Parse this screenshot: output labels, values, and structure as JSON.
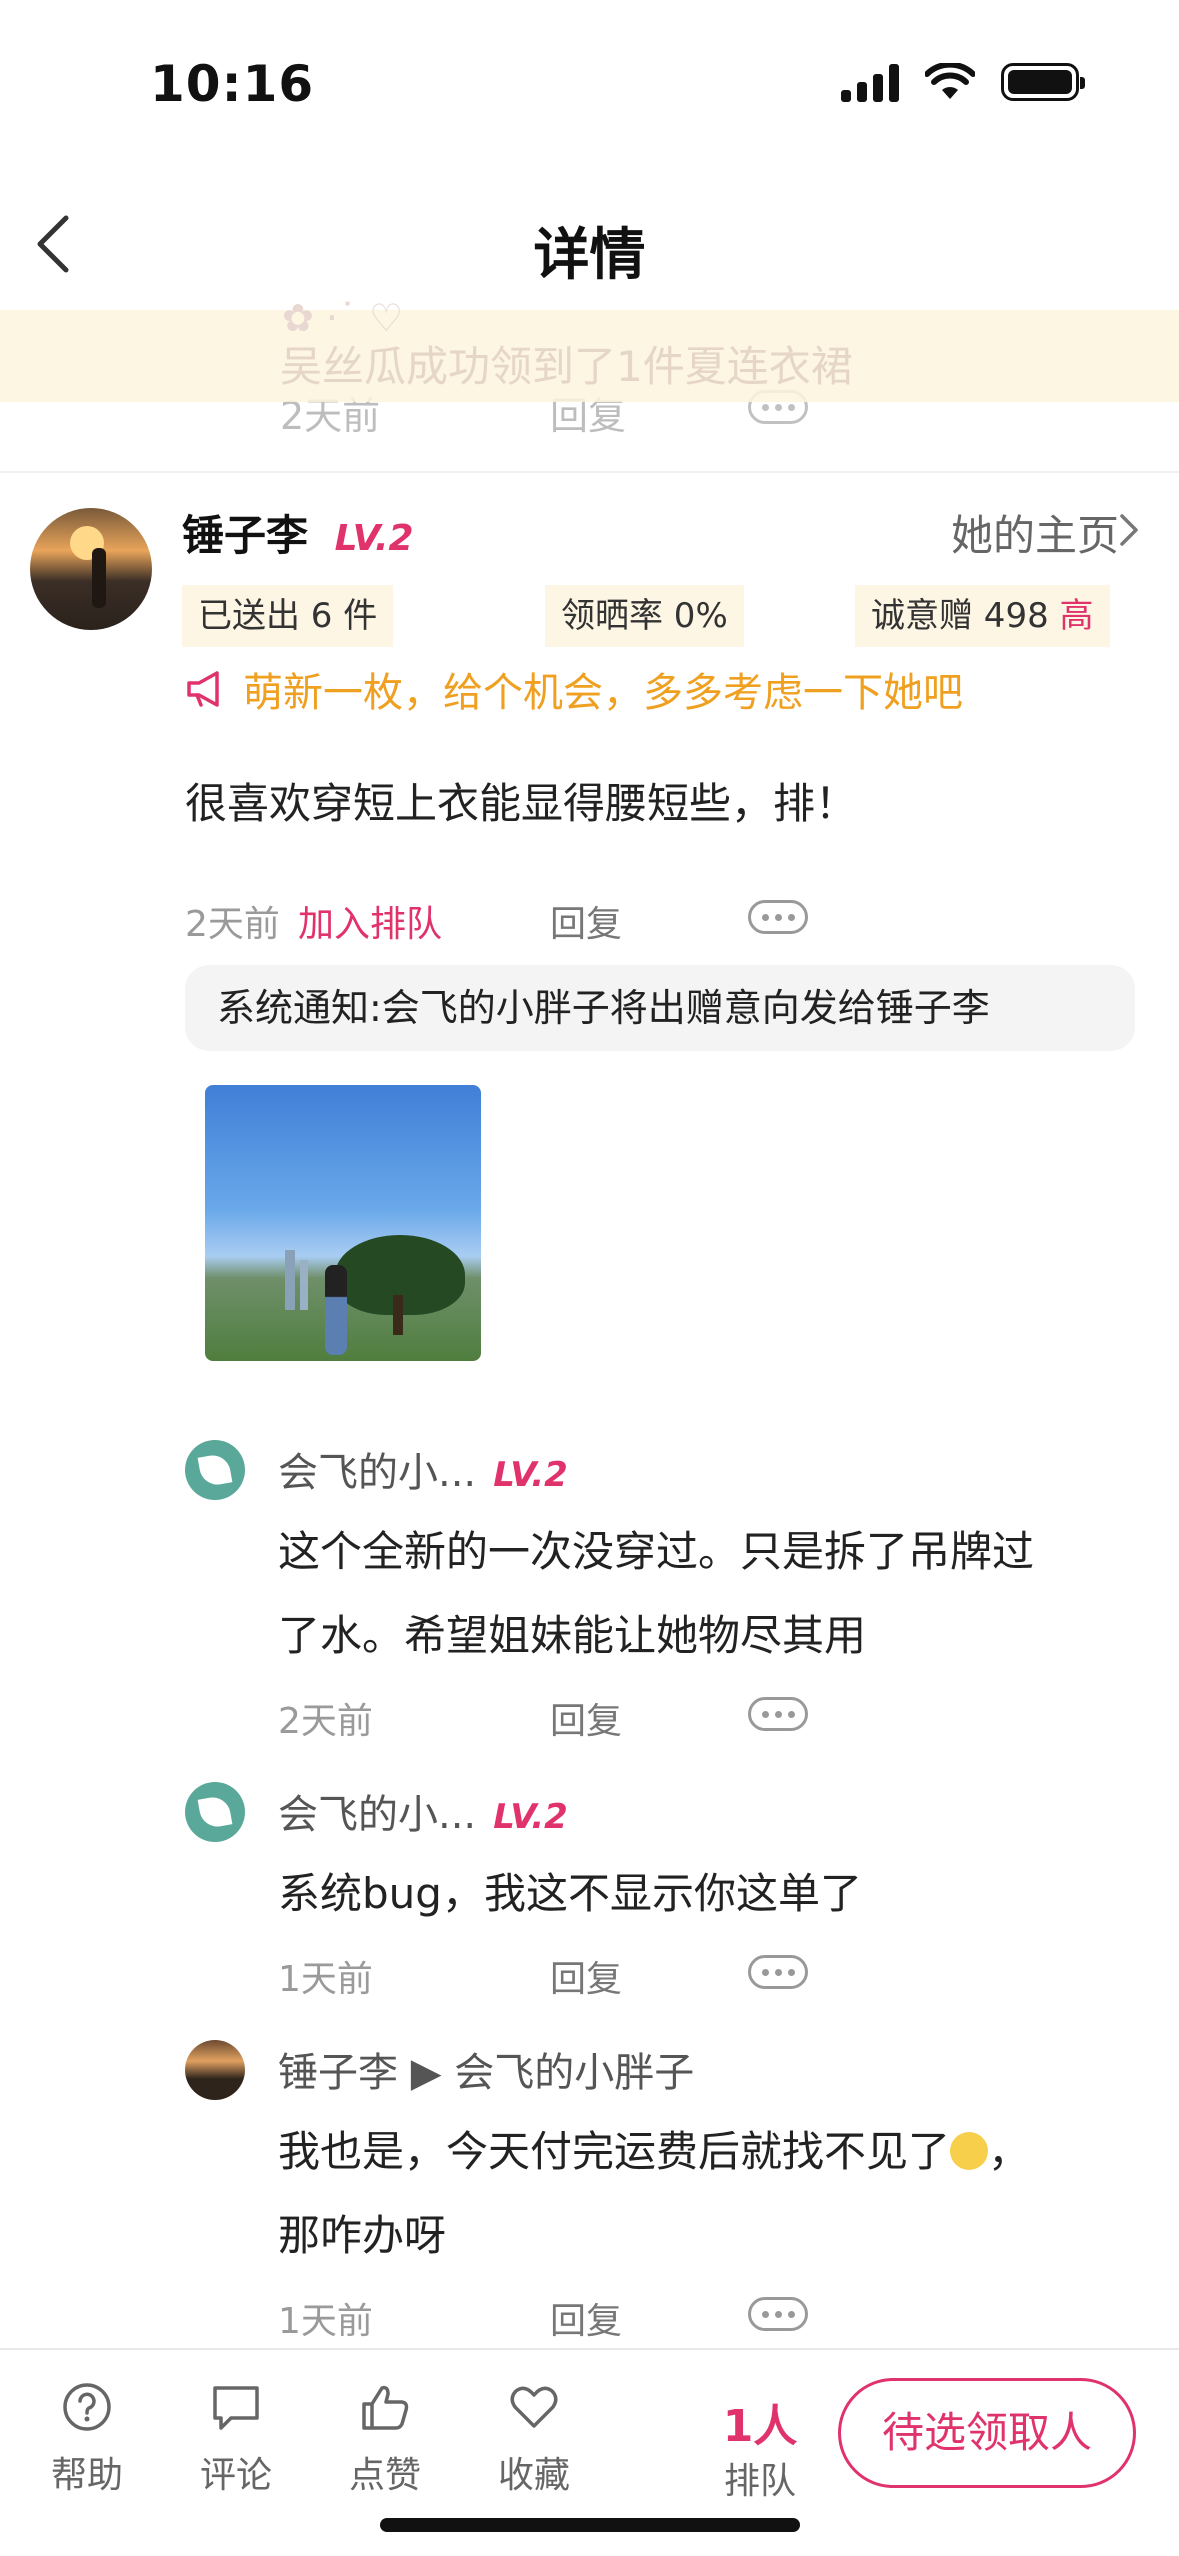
{
  "status_bar": {
    "time": "10:16"
  },
  "nav": {
    "title": "详情"
  },
  "previous_comment": {
    "time": "2天前",
    "reply": "回复"
  },
  "banner": {
    "text": "吴丝瓜成功领到了1件夏连衣裙"
  },
  "post": {
    "user": {
      "name": "锤子李",
      "level": "LV.2",
      "homepage_link": "她的主页"
    },
    "stats": {
      "sent": "已送出 6 件",
      "share_rate": "领晒率 0%",
      "sincerity_label": "诚意赠 498",
      "sincerity_level": "高"
    },
    "hint": "萌新一枚，给个机会，多多考虑一下她吧",
    "text": "很喜欢穿短上衣能显得腰短些，排！",
    "time": "2天前",
    "join_queue": "加入排队",
    "reply": "回复",
    "system_notice": "系统通知:会飞的小胖子将出赠意向发给锤子李"
  },
  "replies": [
    {
      "author": "会飞的小...",
      "level": "LV.2",
      "text_line1": "这个全新的一次没穿过。只是拆了吊牌过",
      "text_line2": "了水。希望姐妹能让她物尽其用",
      "time": "2天前",
      "reply": "回复"
    },
    {
      "author": "会飞的小...",
      "level": "LV.2",
      "text_line1": "系统bug，我这不显示你这单了",
      "time": "1天前",
      "reply": "回复"
    },
    {
      "author": "锤子李",
      "arrow": "▶",
      "target": "会飞的小胖子",
      "text_line1": "我也是，今天付完运费后就找不见了",
      "text_line1_end": "，",
      "text_line2": "那咋办呀",
      "time": "1天前",
      "reply": "回复"
    }
  ],
  "bottom_bar": {
    "help": "帮助",
    "comment": "评论",
    "like": "点赞",
    "favorite": "收藏",
    "queue_count": "1人",
    "queue_label": "排队",
    "cta": "待选领取人"
  },
  "colors": {
    "accent": "#e0336b",
    "hint": "#f0a020",
    "stat_bg": "#fdf6e4"
  }
}
